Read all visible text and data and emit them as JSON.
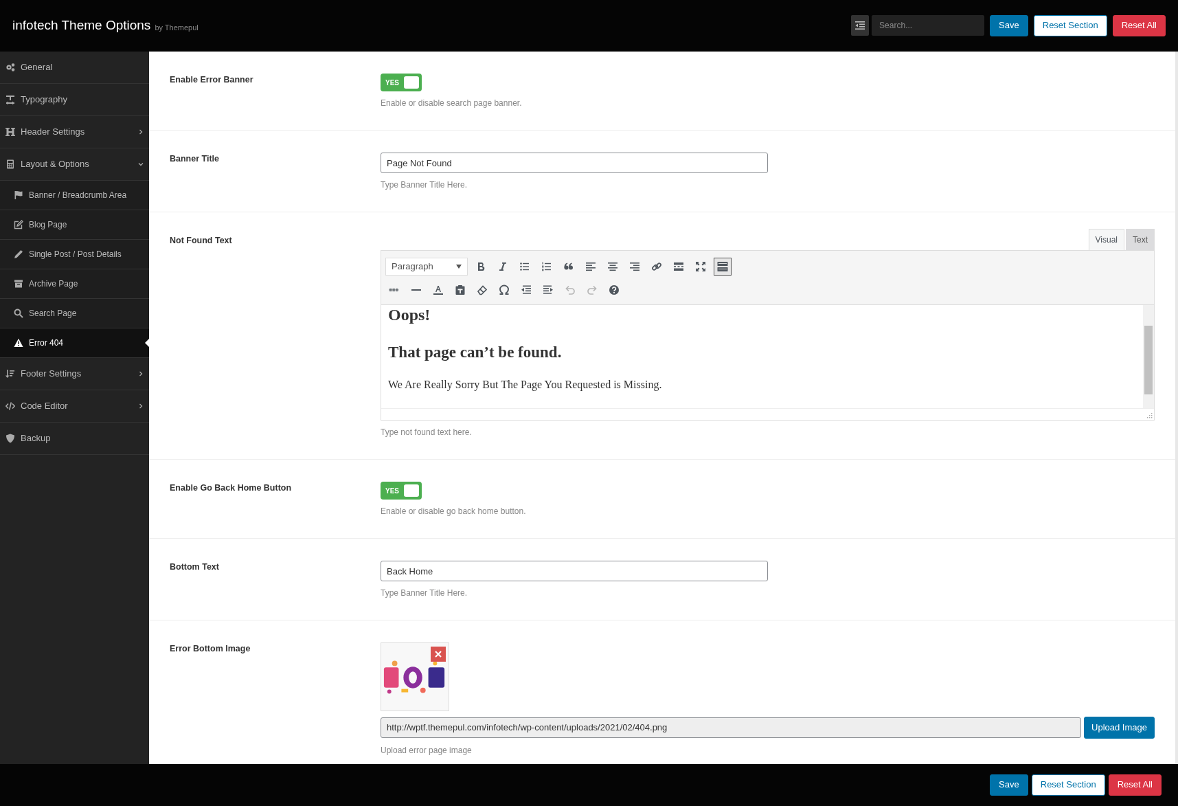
{
  "header": {
    "title": "infotech Theme Options",
    "byline": "by Themepul",
    "search": {
      "placeholder": "Search..."
    },
    "buttons": [
      {
        "label": "Save",
        "kind": "primary"
      },
      {
        "label": "Reset Section",
        "kind": "outline"
      },
      {
        "label": "Reset All",
        "kind": "danger"
      }
    ]
  },
  "sidebar": {
    "items": [
      {
        "label": "General",
        "selected": false
      },
      {
        "label": "Typography",
        "selected": false
      },
      {
        "label": "Header Settings",
        "selected": false,
        "expanded": false
      },
      {
        "label": "Layout & Options",
        "selected": false,
        "expanded": true,
        "children": [
          {
            "label": "Banner / Breadcrumb Area",
            "selected": false
          },
          {
            "label": "Blog Page",
            "selected": false
          },
          {
            "label": "Single Post / Post Details",
            "selected": false
          },
          {
            "label": "Archive Page",
            "selected": false
          },
          {
            "label": "Search Page",
            "selected": false
          },
          {
            "label": "Error 404",
            "selected": true
          }
        ]
      },
      {
        "label": "Footer Settings",
        "selected": false,
        "expanded": false
      },
      {
        "label": "Code Editor",
        "selected": false,
        "expanded": false
      },
      {
        "label": "Backup",
        "selected": false
      }
    ]
  },
  "fields": [
    {
      "kind": "switch",
      "label": "Enable Error Banner",
      "on": true,
      "switch_text": "YES",
      "description": "Enable or disable search page banner."
    },
    {
      "kind": "text",
      "label": "Banner Title",
      "value": "Page Not Found",
      "description": "Type Banner Title Here."
    },
    {
      "kind": "editor",
      "label": "Not Found Text",
      "tabs": [
        {
          "label": "Visual",
          "selected": true
        },
        {
          "label": "Text",
          "selected": false
        }
      ],
      "format": "Paragraph",
      "toolbar": [
        [
          {
            "pressed": false,
            "disabled": false
          },
          {
            "pressed": false,
            "disabled": false
          },
          {
            "pressed": false,
            "disabled": false
          },
          {
            "pressed": false,
            "disabled": false
          },
          {
            "pressed": false,
            "disabled": false
          },
          {
            "pressed": false,
            "disabled": false
          },
          {
            "pressed": false,
            "disabled": false
          },
          {
            "pressed": false,
            "disabled": false
          },
          {
            "pressed": false,
            "disabled": false
          },
          {
            "pressed": false,
            "disabled": false
          },
          {
            "pressed": false,
            "disabled": false
          },
          {
            "pressed": true,
            "disabled": false
          }
        ],
        [
          {
            "pressed": false,
            "disabled": false
          },
          {
            "pressed": false,
            "disabled": false
          },
          {
            "pressed": false,
            "disabled": false
          },
          {
            "pressed": false,
            "disabled": false
          },
          {
            "pressed": false,
            "disabled": false
          },
          {
            "pressed": false,
            "disabled": false
          },
          {
            "pressed": false,
            "disabled": false
          },
          {
            "pressed": false,
            "disabled": false
          },
          {
            "pressed": false,
            "disabled": true
          },
          {
            "pressed": false,
            "disabled": true
          },
          {
            "pressed": false,
            "disabled": false
          }
        ]
      ],
      "content": [
        {
          "kind": "h1",
          "text": "Oops!"
        },
        {
          "kind": "h2",
          "text": "That page can’t be found."
        },
        {
          "kind": "p",
          "text": "We Are Really Sorry But The Page You Requested is Missing."
        }
      ],
      "description": "Type not found text here."
    },
    {
      "kind": "switch",
      "label": "Enable Go Back Home Button",
      "on": true,
      "switch_text": "YES",
      "description": "Enable or disable go back home button."
    },
    {
      "kind": "text",
      "label": "Bottom Text",
      "value": "Back Home",
      "description": "Type Banner Title Here."
    },
    {
      "kind": "media",
      "label": "Error Bottom Image",
      "url": "http://wptf.themepul.com/infotech/wp-content/uploads/2021/02/404.png",
      "button": "Upload Image",
      "description": "Upload error page image"
    }
  ],
  "footer": {
    "buttons": [
      {
        "label": "Save",
        "kind": "primary"
      },
      {
        "label": "Reset Section",
        "kind": "outline"
      },
      {
        "label": "Reset All",
        "kind": "danger"
      }
    ]
  }
}
